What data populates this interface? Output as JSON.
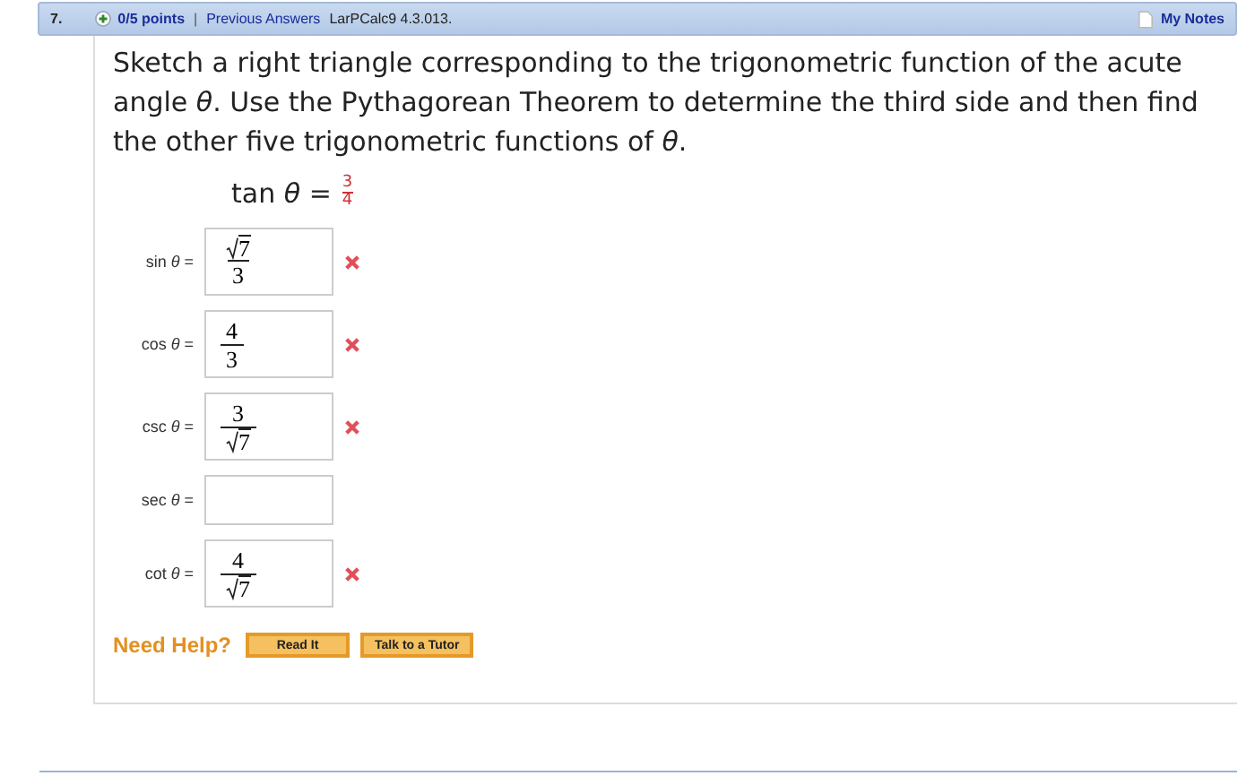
{
  "header": {
    "number": "7.",
    "points": "0/5 points",
    "separator": "|",
    "previous_answers": "Previous Answers",
    "source": "LarPCalc9 4.3.013.",
    "notes": "My Notes"
  },
  "question": "Sketch a right triangle corresponding to the trigonometric function of the acute angle *θ*. Use the Pythagorean Theorem to determine the third side and then find the other five trigonometric functions of *θ*.",
  "given": {
    "lhs": "tan *θ* =",
    "numerator": "3",
    "denominator": "4"
  },
  "answers": [
    {
      "label": "sin *θ* =",
      "numerator": {
        "kind": "sqrt",
        "text": "7"
      },
      "denominator": {
        "kind": "plain",
        "text": "3"
      },
      "marked_wrong": true
    },
    {
      "label": "cos *θ* =",
      "numerator": {
        "kind": "plain",
        "text": "4"
      },
      "denominator": {
        "kind": "plain",
        "text": "3"
      },
      "marked_wrong": true
    },
    {
      "label": "csc *θ* =",
      "numerator": {
        "kind": "plain",
        "text": "3"
      },
      "denominator": {
        "kind": "sqrt",
        "text": "7"
      },
      "marked_wrong": true
    },
    {
      "label": "sec *θ* =",
      "marked_wrong": false
    },
    {
      "label": "cot *θ* =",
      "numerator": {
        "kind": "plain",
        "text": "4"
      },
      "denominator": {
        "kind": "sqrt",
        "text": "7"
      },
      "marked_wrong": true
    }
  ],
  "help": {
    "label": "Need Help?",
    "buttons": [
      "Read It",
      "Talk to a Tutor"
    ]
  }
}
